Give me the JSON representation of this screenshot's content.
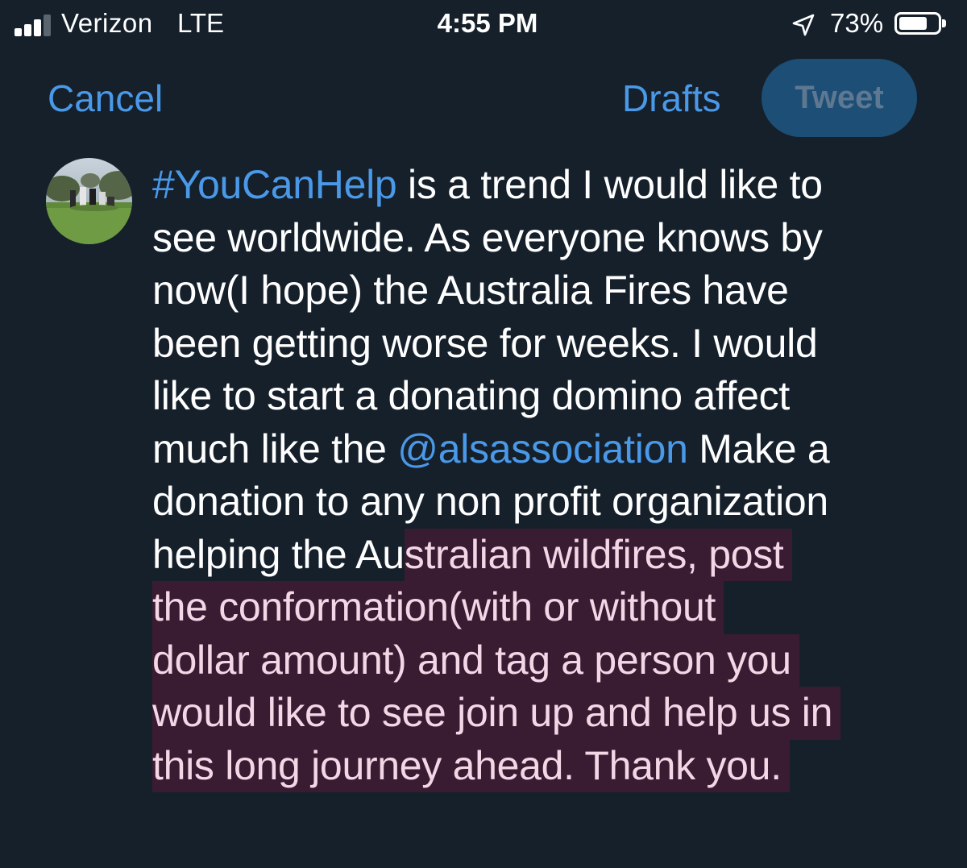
{
  "status_bar": {
    "carrier": "Verizon",
    "network": "LTE",
    "time": "4:55 PM",
    "battery_percent": "73%",
    "battery_level": 0.73
  },
  "compose": {
    "cancel_label": "Cancel",
    "drafts_label": "Drafts",
    "tweet_label": "Tweet"
  },
  "tweet": {
    "lines": [
      {
        "parts": [
          {
            "text": "#YouCanHelp",
            "type": "link"
          },
          {
            "text": " is a trend I would like to",
            "type": "normal"
          }
        ]
      },
      {
        "parts": [
          {
            "text": "see worldwide. As everyone knows by",
            "type": "normal"
          }
        ]
      },
      {
        "parts": [
          {
            "text": "now(I hope) the Australia Fires have",
            "type": "normal"
          }
        ]
      },
      {
        "parts": [
          {
            "text": "been getting worse for weeks. I would",
            "type": "normal"
          }
        ]
      },
      {
        "parts": [
          {
            "text": "like to start a donating domino affect",
            "type": "normal"
          }
        ]
      },
      {
        "parts": [
          {
            "text": "much like the ",
            "type": "normal"
          },
          {
            "text": "@alsassociation",
            "type": "link"
          },
          {
            "text": " Make a",
            "type": "normal"
          }
        ]
      },
      {
        "parts": [
          {
            "text": "donation to any non profit organization",
            "type": "normal"
          }
        ]
      },
      {
        "parts": [
          {
            "text": "helping the Au",
            "type": "normal"
          },
          {
            "text": "stralian wildfires, post",
            "type": "over"
          }
        ]
      },
      {
        "parts": [
          {
            "text": "the conformation(with or without",
            "type": "over"
          }
        ]
      },
      {
        "parts": [
          {
            "text": "dollar amount) and tag a person you",
            "type": "over"
          }
        ]
      },
      {
        "parts": [
          {
            "text": "would like to see join up and help us in",
            "type": "over"
          }
        ]
      },
      {
        "parts": [
          {
            "text": "this long journey ahead. Thank you.",
            "type": "over"
          }
        ]
      }
    ]
  },
  "colors": {
    "background": "#15202b",
    "link": "#4a99e9",
    "tweet_button_bg": "#1d4e76",
    "tweet_button_text": "#5e7891",
    "overflow_highlight": "#3a1c32",
    "overflow_text": "#f4d7e6"
  },
  "icons": {
    "signal": "signal-strength-icon",
    "location": "location-arrow-icon",
    "battery": "battery-icon"
  }
}
